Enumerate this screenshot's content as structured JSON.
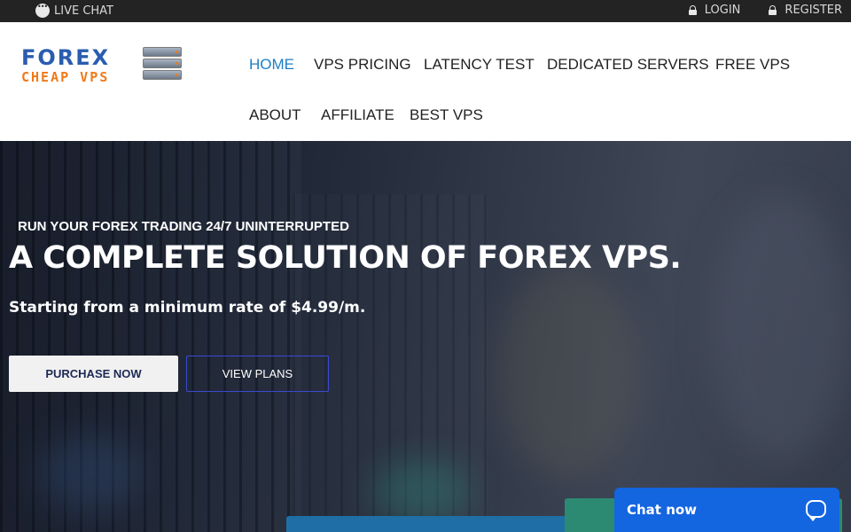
{
  "topbar": {
    "live_chat": "LIVE CHAT",
    "login": "LOGIN",
    "register": "REGISTER"
  },
  "logo": {
    "line1": "FOREX",
    "line2": "CHEAP VPS",
    "icon": "server-rack-icon"
  },
  "nav": {
    "items": [
      {
        "label": "HOME",
        "active": true
      },
      {
        "label": "VPS PRICING"
      },
      {
        "label": "LATENCY TEST"
      },
      {
        "label": "DEDICATED SERVERS"
      },
      {
        "label": "FREE VPS"
      },
      {
        "label": "ABOUT"
      },
      {
        "label": "AFFILIATE"
      },
      {
        "label": "BEST VPS"
      }
    ]
  },
  "hero": {
    "eyebrow": "RUN YOUR FOREX TRADING 24/7 UNINTERRUPTED",
    "headline": "A COMPLETE SOLUTION OF FOREX VPS.",
    "subtitle": "Starting from a minimum rate of $4.99/m.",
    "primary_button": "PURCHASE NOW",
    "secondary_button": "VIEW PLANS"
  },
  "chat_widget": {
    "label": "Chat now",
    "icon": "chat-bubble-icon"
  },
  "colors": {
    "nav_active": "#1d7ec7",
    "logo_blue": "#2a5db0",
    "logo_orange": "#f07a1a",
    "chat_blue": "#1465e0"
  }
}
